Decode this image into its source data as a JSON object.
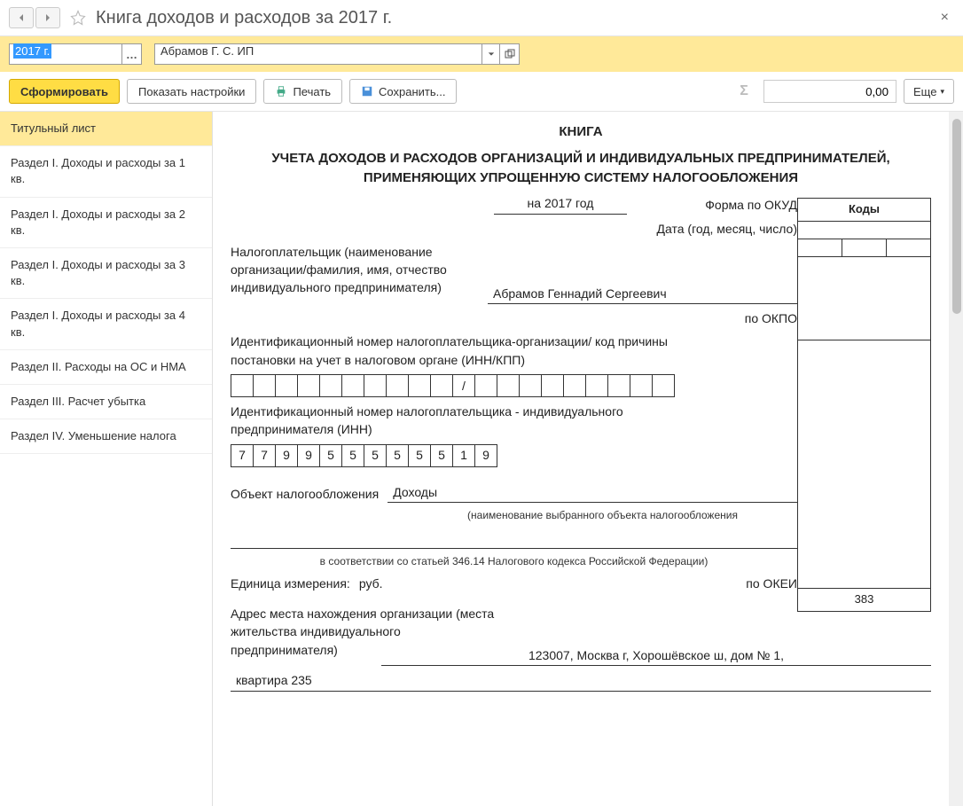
{
  "title": "Книга доходов и расходов за 2017 г.",
  "period": "2017 г.",
  "organization": "Абрамов Г. С. ИП",
  "toolbar": {
    "form": "Сформировать",
    "settings": "Показать настройки",
    "print": "Печать",
    "save": "Сохранить...",
    "sum": "0,00",
    "more": "Еще"
  },
  "sections": [
    "Титульный лист",
    "Раздел I. Доходы и расходы за 1 кв.",
    "Раздел I. Доходы и расходы за 2 кв.",
    "Раздел I. Доходы и расходы за 3 кв.",
    "Раздел I. Доходы и расходы за 4 кв.",
    "Раздел II. Расходы на ОС и НМА",
    "Раздел III. Расчет убытка",
    "Раздел IV. Уменьшение налога"
  ],
  "doc": {
    "h1": "КНИГА",
    "h2": "УЧЕТА ДОХОДОВ И РАСХОДОВ ОРГАНИЗАЦИЙ И ИНДИВИДУАЛЬНЫХ ПРЕДПРИНИМАТЕЛЕЙ, ПРИМЕНЯЮЩИХ УПРОЩЕННУЮ СИСТЕМУ НАЛОГООБЛОЖЕНИЯ",
    "codes_header": "Коды",
    "year_label": "на 2017 год",
    "form_okud": "Форма по ОКУД",
    "date_label": "Дата (год, месяц, число)",
    "taxpayer_label": "Налогоплательщик (наименование организации/фамилия, имя, отчество индивидуального предпринимателя)",
    "taxpayer_name": "Абрамов Геннадий Сергеевич",
    "okpo_label": "по ОКПО",
    "inn_kpp_label": "Идентификационный номер налогоплательщика-организации/ код причины постановки на учет в налоговом органе (ИНН/КПП)",
    "inn_label": "Идентификационный номер налогоплательщика - индивидуального предпринимателя (ИНН)",
    "inn": [
      "7",
      "7",
      "9",
      "9",
      "5",
      "5",
      "5",
      "5",
      "5",
      "5",
      "1",
      "9"
    ],
    "object_label": "Объект налогообложения",
    "object_value": "Доходы",
    "object_hint": "(наименование выбранного объекта налогообложения",
    "article_hint": "в соответствии со статьей 346.14 Налогового кодекса Российской Федерации)",
    "unit_label": "Единица измерения:",
    "unit_value": "руб.",
    "okei_label": "по ОКЕИ",
    "okei_code": "383",
    "address_label": "Адрес места нахождения организации (места жительства индивидуального предпринимателя)",
    "address_line1": "123007, Москва г, Хорошёвское ш, дом № 1,",
    "address_line2": "квартира 235"
  }
}
